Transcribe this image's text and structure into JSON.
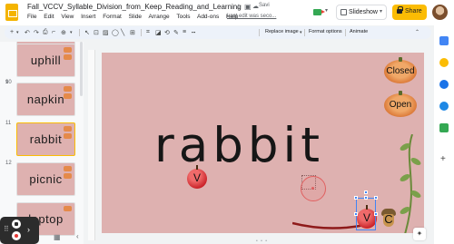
{
  "app": {
    "doc_title": "Fall_VCCV_Syllable_Division_from_Keep_Reading_and_Learning",
    "save_status": "Savi",
    "last_edit": "Last edit was seco...",
    "menu": [
      "File",
      "Edit",
      "View",
      "Insert",
      "Format",
      "Slide",
      "Arrange",
      "Tools",
      "Add-ons",
      "Help"
    ],
    "slideshow_label": "Slideshow",
    "share_label": "Share"
  },
  "toolbar": {
    "replace_image": "Replace image",
    "format_options": "Format options",
    "animate": "Animate",
    "icons": [
      "add-icon",
      "undo-icon",
      "redo-icon",
      "print-icon",
      "paint-format-icon",
      "zoom-icon",
      "select-icon",
      "textbox-icon",
      "image-icon",
      "shapes-icon",
      "line-icon",
      "comment-icon",
      "crop-icon",
      "mask-icon",
      "reset-icon",
      "border-color-icon",
      "border-weight-icon",
      "border-dash-icon"
    ]
  },
  "filmstrip": {
    "slides": [
      {
        "num": "",
        "word": ""
      },
      {
        "num": "9",
        "word": "uphill"
      },
      {
        "num": "10",
        "word": "napkin"
      },
      {
        "num": "11",
        "word": "rabbit"
      },
      {
        "num": "12",
        "word": "picnic"
      },
      {
        "num": "",
        "word": "laptop"
      }
    ],
    "selected_index": 3
  },
  "slide": {
    "word": "rabbit",
    "buttons": {
      "closed": "Closed",
      "open": "Open"
    },
    "apple_label": "V",
    "selected_apple_label": "V",
    "acorn_label": "C",
    "colors": {
      "background": "#deb1b0",
      "pumpkin": "#dc7b3a",
      "apple": "#c81e25",
      "selection": "#4285f4"
    }
  },
  "side_panel_icons": [
    "calendar-icon",
    "keep-icon",
    "tasks-icon",
    "contacts-icon",
    "maps-icon",
    "add-icon"
  ]
}
